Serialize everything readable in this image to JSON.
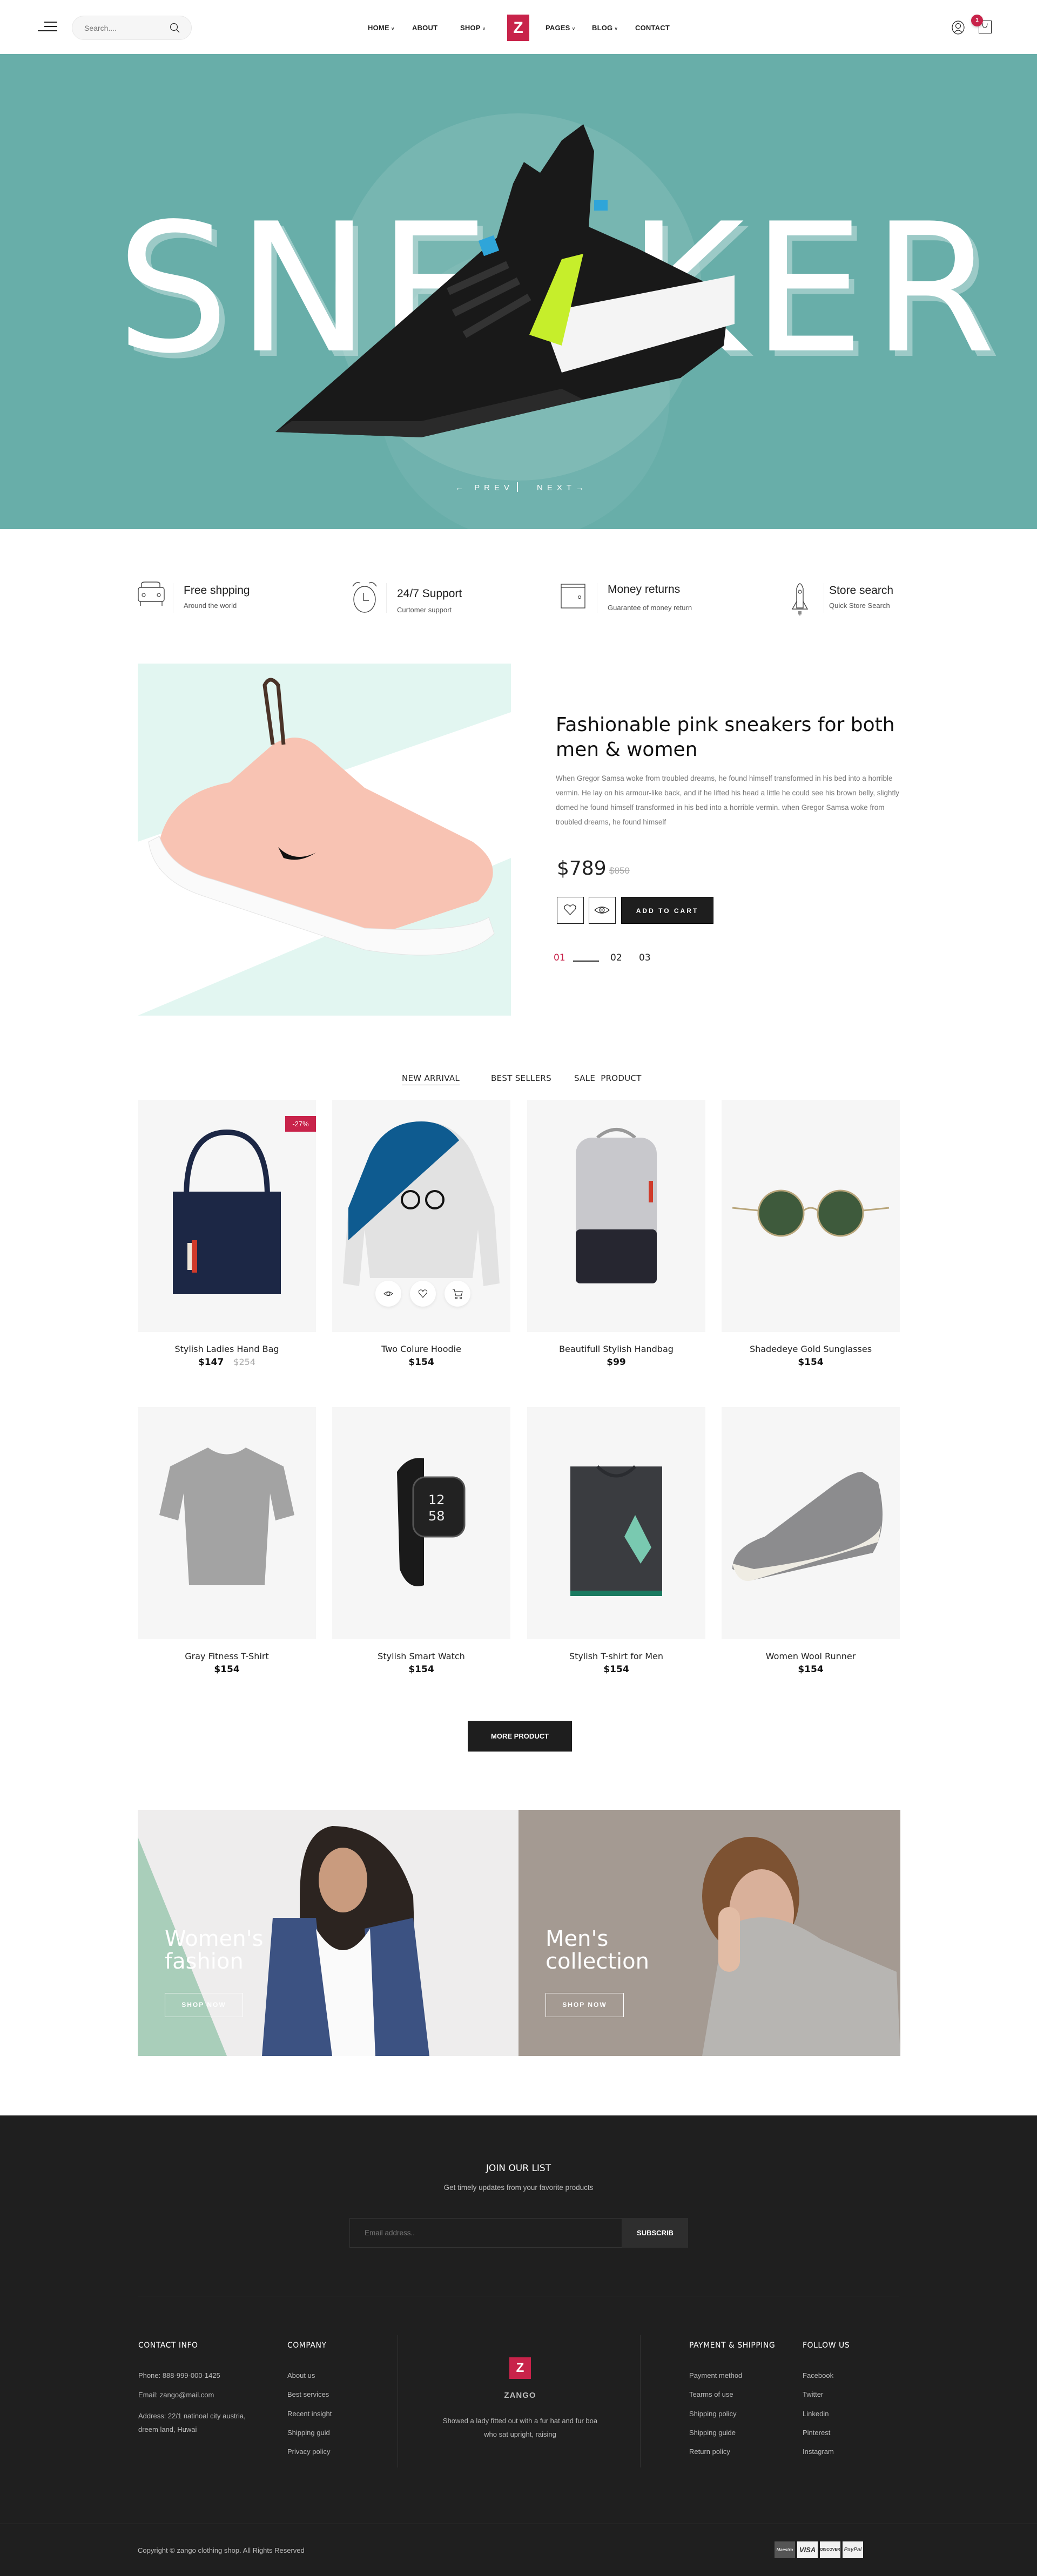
{
  "header": {
    "search_placeholder": "Search....",
    "nav": [
      {
        "label": "HOME",
        "has_dropdown": true
      },
      {
        "label": "ABOUT",
        "has_dropdown": false
      },
      {
        "label": "SHOP",
        "has_dropdown": true
      },
      {
        "label": "PAGES",
        "has_dropdown": true
      },
      {
        "label": "BLOG",
        "has_dropdown": true
      },
      {
        "label": "CONTACT",
        "has_dropdown": false
      }
    ],
    "logo_letter": "Z",
    "cart_count": "1",
    "brand_color": "#c8234a"
  },
  "hero": {
    "title": "SNEAKER",
    "prev_label": "PREV",
    "next_label": "NEXT",
    "bg_color": "#68aea9"
  },
  "features": [
    {
      "icon": "car-icon",
      "title": "Free shpping",
      "subtitle": "Around the world"
    },
    {
      "icon": "alarm-clock-icon",
      "title": "24/7 Support",
      "subtitle": "Curtomer support"
    },
    {
      "icon": "wallet-icon",
      "title": "Money returns",
      "subtitle": "Guarantee of money return"
    },
    {
      "icon": "rocket-icon",
      "title": "Store search",
      "subtitle": "Quick Store Search"
    }
  ],
  "promo": {
    "title": "Fashionable pink sneakers for both men & women",
    "description": "When Gregor Samsa woke from troubled dreams, he found himself transformed in his bed into a horrible vermin. He lay on his armour-like back, and if he lifted his head a little he could see his brown belly, slightly domed he found himself transformed in his bed into a horrible vermin. when Gregor Samsa woke from troubled dreams, he found himself",
    "price": "$789",
    "old_price": "$850",
    "add_to_cart": "ADD TO CART",
    "pages": [
      "01",
      "02",
      "03"
    ],
    "active_page": "01"
  },
  "tabs": [
    {
      "label": "NEW ARRIVAL",
      "active": true
    },
    {
      "label": "BEST SELLERS",
      "active": false
    },
    {
      "label": "SALE  PRODUCT",
      "active": false
    }
  ],
  "products": [
    {
      "name": "Stylish Ladies Hand Bag",
      "price": "$147",
      "old_price": "$254",
      "badge": "-27%"
    },
    {
      "name": "Two Colure Hoodie",
      "price": "$154"
    },
    {
      "name": "Beautifull Stylish Handbag",
      "price": "$99"
    },
    {
      "name": "Shadedeye Gold Sunglasses",
      "price": "$154"
    },
    {
      "name": "Gray Fitness T-Shirt",
      "price": "$154"
    },
    {
      "name": "Stylish Smart Watch",
      "price": "$154"
    },
    {
      "name": "Stylish T-shirt for Men",
      "price": "$154"
    },
    {
      "name": "Women Wool Runner",
      "price": "$154"
    }
  ],
  "more_product": "MORE PRODUCT",
  "banners": [
    {
      "title_line1": "Women's",
      "title_line2": "fashion",
      "button": "SHOP NOW"
    },
    {
      "title_line1": "Men's",
      "title_line2": "collection",
      "button": "SHOP NOW"
    }
  ],
  "footer": {
    "join_title": "JOIN OUR LIST",
    "join_subtitle": "Get timely updates from your favorite products",
    "email_placeholder": "Email address..",
    "subscribe": "SUBSCRIB",
    "contact": {
      "title": "CONTACT INFO",
      "phone": "Phone: 888-999-000-1425",
      "email": "Email: zango@mail.com",
      "address_line1": "Address: 22/1 natinoal city austria,",
      "address_line2": "dreem land, Huwai"
    },
    "company": {
      "title": "COMPANY",
      "items": [
        "About us",
        "Best services",
        "Recent insight",
        "Shipping guid",
        "Privacy policy"
      ]
    },
    "brand": {
      "logo_letter": "Z",
      "name": "ZANGO",
      "description": "Showed a lady fitted out with a fur hat and fur boa who sat upright, raising"
    },
    "payment": {
      "title": "PAYMENT & SHIPPING",
      "items": [
        "Payment method",
        "Tearms of use",
        "Shipping policy",
        "Shipping guide",
        "Return policy"
      ]
    },
    "follow": {
      "title": "FOLLOW US",
      "items": [
        "Facebook",
        "Twitter",
        "Linkedin",
        "Pinterest",
        "Instagram"
      ]
    },
    "copyright": "Copyright © zango clothing shop. All Rights Reserved",
    "payment_cards": [
      "Maestro",
      "VISA",
      "DISCOVER",
      "PayPal"
    ]
  }
}
